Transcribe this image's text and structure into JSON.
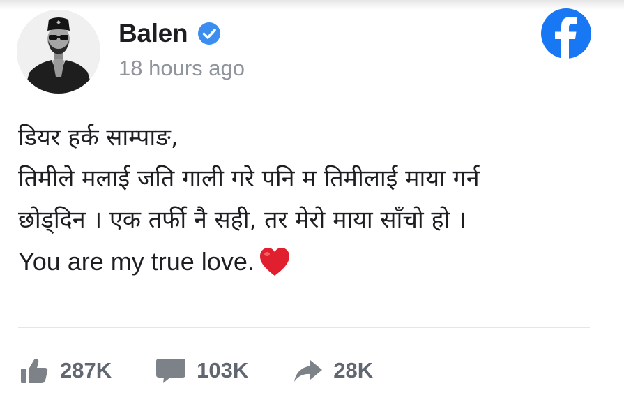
{
  "author": {
    "name": "Balen",
    "timestamp": "18 hours ago",
    "verified": true
  },
  "post": {
    "lines": [
      "डियर हर्क साम्पाङ,",
      "तिमीले मलाई जति गाली गरे पनि म तिमीलाई माया गर्न",
      "छोड्दिन । एक तर्फी नै सही, तर मेरो माया साँचो हो ।",
      "You are my true love."
    ],
    "emoji": "heart"
  },
  "stats": {
    "likes": "287K",
    "comments": "103K",
    "shares": "28K"
  },
  "colors": {
    "facebook_blue": "#1877f2",
    "verified_blue": "#3b8df0",
    "muted_text": "#90949c",
    "stat_gray": "#606770",
    "heart_red": "#e0202e"
  }
}
